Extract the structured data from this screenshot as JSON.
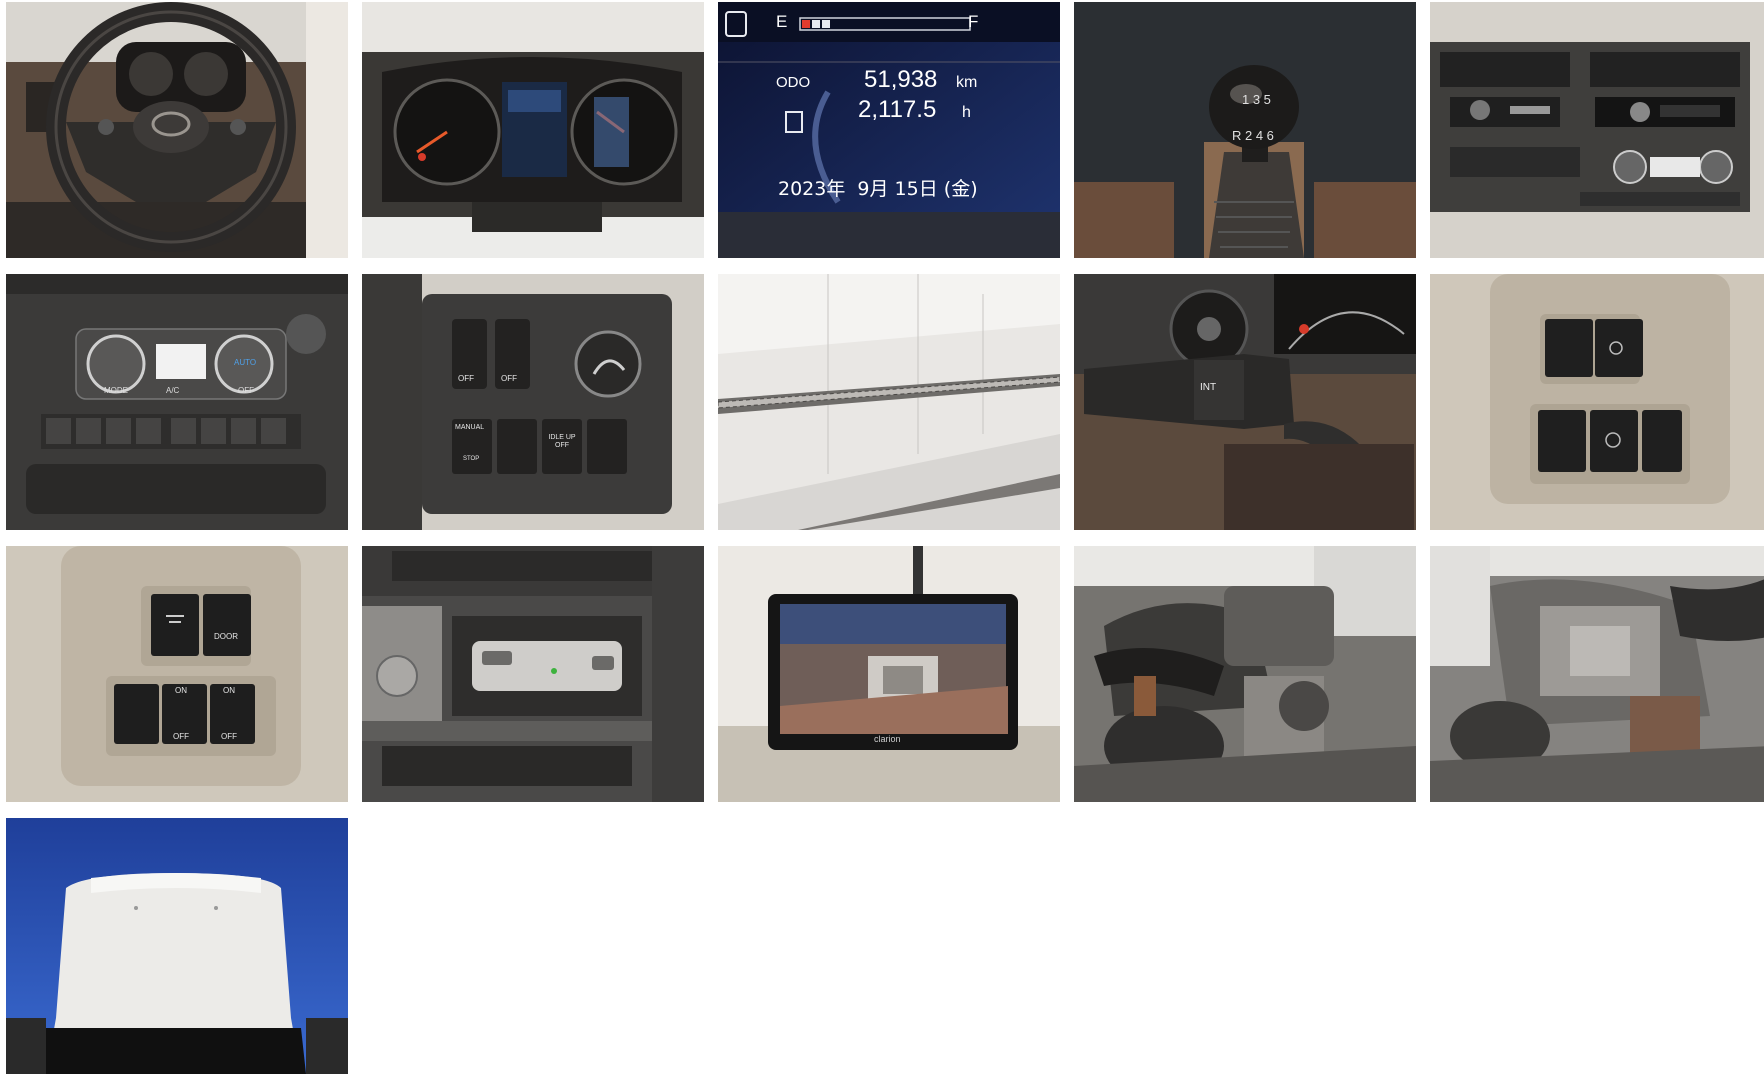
{
  "gallery": {
    "photos": [
      {
        "subject": "steering-wheel-dashboard"
      },
      {
        "subject": "instrument-cluster"
      },
      {
        "subject": "odometer-display",
        "fuel_e": "E",
        "fuel_f": "F",
        "odo_label": "ODO",
        "odo_value": "51,938",
        "odo_unit": "km",
        "hours_value": "2,117.5",
        "hours_unit": "h",
        "date_text": "2023年  9月 15日 (金)"
      },
      {
        "subject": "gear-shift-knob",
        "pattern_top": "1 3 5",
        "pattern_bottom": "R 2 4 6"
      },
      {
        "subject": "center-console-audio"
      },
      {
        "subject": "climate-control-panel",
        "mode_label": "MODE",
        "auto_label": "AUTO",
        "ac_label": "A/C",
        "off_label": "OFF"
      },
      {
        "subject": "dash-switch-panel",
        "off_label": "OFF",
        "manual_label": "MANUAL",
        "stop_label": "STOP",
        "idle_label": "IDLE UP OFF"
      },
      {
        "subject": "cargo-box-interior"
      },
      {
        "subject": "wiper-stalk",
        "int_label": "INT"
      },
      {
        "subject": "lower-dash-switches"
      },
      {
        "subject": "door-light-switches",
        "door_label": "DOOR",
        "on_label": "ON",
        "off_label": "OFF"
      },
      {
        "subject": "etc-card-reader"
      },
      {
        "subject": "rear-view-monitor",
        "brand": "clarion"
      },
      {
        "subject": "engine-bay-left"
      },
      {
        "subject": "engine-bay-right"
      },
      {
        "subject": "cab-roof-exterior"
      }
    ]
  }
}
